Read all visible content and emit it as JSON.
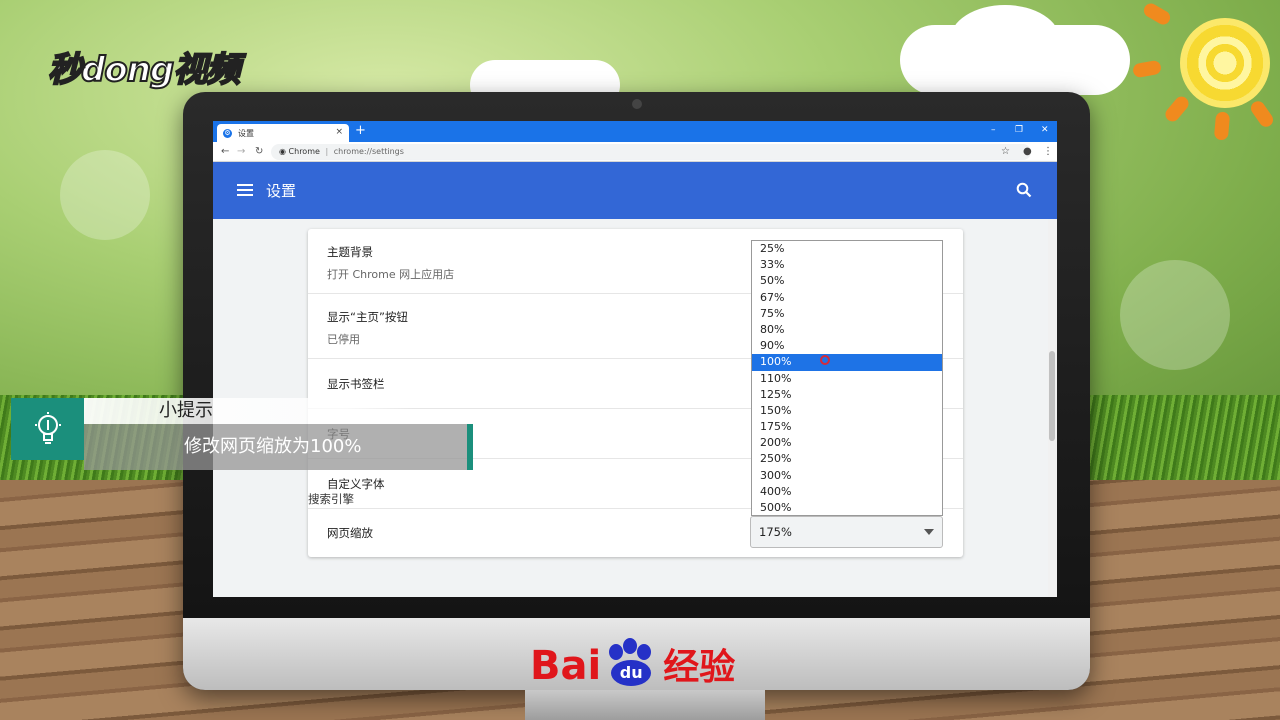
{
  "watermark": {
    "logo_text": "秒dong视频"
  },
  "browser": {
    "tab_title": "设置",
    "tab_close": "×",
    "new_tab": "+",
    "win_min": "–",
    "win_restore": "❐",
    "win_close": "✕",
    "omnibox": {
      "site": "Chrome",
      "separator": "|",
      "url": "chrome://settings"
    }
  },
  "settings": {
    "title": "设置",
    "rows": [
      {
        "label": "主题背景",
        "sub": "打开 Chrome 网上应用店"
      },
      {
        "label": "显示“主页”按钮",
        "sub": "已停用"
      },
      {
        "label": "显示书签栏",
        "sub": ""
      },
      {
        "label": "字号",
        "sub": ""
      },
      {
        "label": "自定义字体",
        "sub": ""
      },
      {
        "label": "网页缩放",
        "sub": ""
      }
    ],
    "next_section": "搜索引擎"
  },
  "zoom": {
    "options": [
      "25%",
      "33%",
      "50%",
      "67%",
      "75%",
      "80%",
      "90%",
      "100%",
      "110%",
      "125%",
      "150%",
      "175%",
      "200%",
      "250%",
      "300%",
      "400%",
      "500%"
    ],
    "highlighted": "100%",
    "selected": "175%"
  },
  "tip": {
    "heading": "小提示",
    "text": "修改网页缩放为100%"
  },
  "brand": {
    "baidu_left": "Bai",
    "baidu_paw": "du",
    "baidu_right": "经验"
  },
  "colors": {
    "chrome_blue": "#1a73e8",
    "header_blue": "#3367d6",
    "tip_teal": "#1b8f7c",
    "baidu_red": "#e0161b",
    "baidu_blue": "#2531c7"
  }
}
